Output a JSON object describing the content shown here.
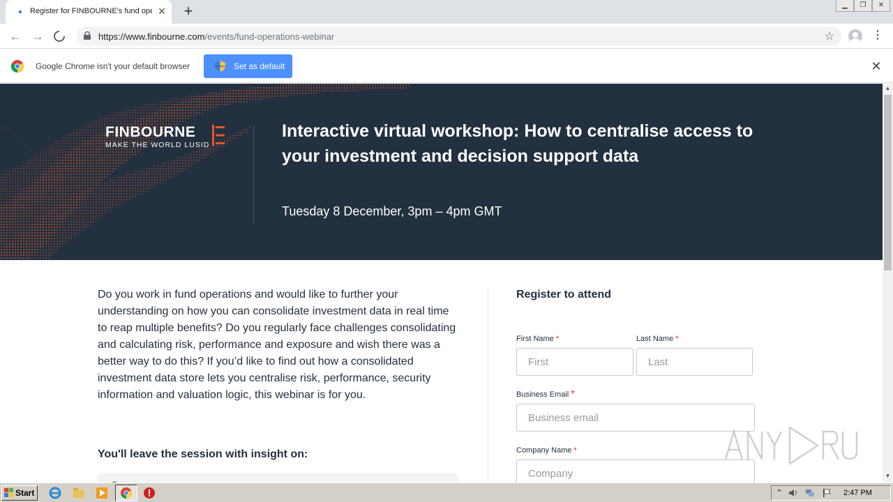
{
  "browser": {
    "tab_title": "Register for FINBOURNE's fund operations webinar",
    "new_tab_symbol": "+",
    "close_tab_symbol": "✕",
    "url_host": "https://www.finbourne.com",
    "url_path": "/events/fund-operations-webinar",
    "menu_symbol": "⋮",
    "star_symbol": "☆"
  },
  "infobar": {
    "message": "Google Chrome isn't your default browser",
    "button_label": "Set as default",
    "close_symbol": "✕"
  },
  "hero": {
    "brand_name": "FINBOURNE",
    "brand_tagline": "MAKE THE WORLD LUSID",
    "title": "Interactive virtual workshop: How to centralise access to your investment and decision support data",
    "date": "Tuesday 8 December, 3pm – 4pm GMT"
  },
  "content": {
    "intro": "Do you work in fund operations and would like to further your understanding on how you can consolidate investment data in real time to reap multiple benefits? Do you regularly face challenges consolidating and calculating risk, performance and exposure and wish there was a better way to do this? If you’d like to find out how a consolidated investment data store lets you centralise risk, performance, security information and valuation logic, this webinar is for you.",
    "insight_heading": "You'll leave the session with insight on:"
  },
  "form": {
    "heading": "Register to attend",
    "required_mark": "*",
    "first_name_label": "First Name",
    "first_name_placeholder": "First",
    "last_name_label": "Last Name",
    "last_name_placeholder": "Last",
    "email_label": "Business Email",
    "email_placeholder": "Business email",
    "company_label": "Company Name",
    "company_placeholder": "Company"
  },
  "taskbar": {
    "start_label": "Start",
    "clock": "2:47 PM"
  },
  "colors": {
    "hero_bg": "#22303f",
    "accent_orange": "#e8562a",
    "chrome_blue": "#4d90fe",
    "required_red": "#e8231e"
  }
}
